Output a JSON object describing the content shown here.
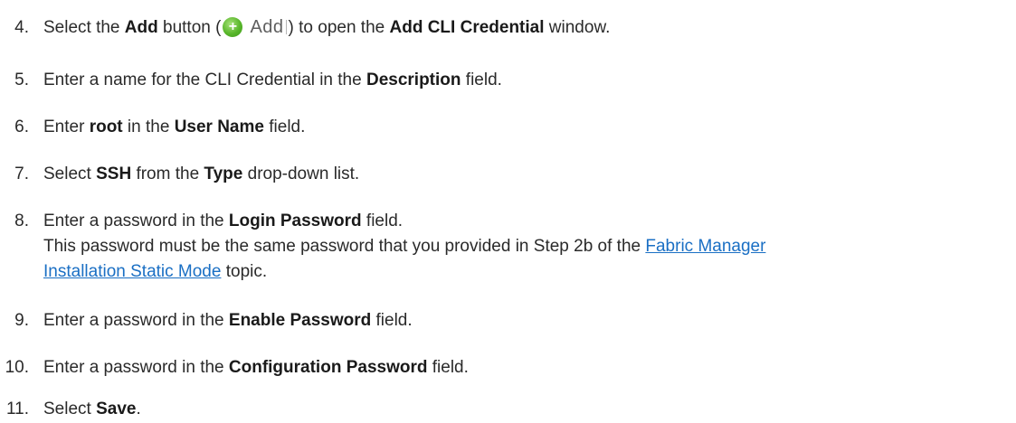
{
  "steps": [
    {
      "number": "4.",
      "parts": {
        "a": "Select the ",
        "b": "Add",
        "c": " button (",
        "icon_label": "Add",
        "d": ") to open the ",
        "e": "Add CLI Credential",
        "f": " window."
      }
    },
    {
      "number": "5.",
      "parts": {
        "a": "Enter a name for the CLI Credential in the ",
        "b": "Description",
        "c": " field."
      }
    },
    {
      "number": "6.",
      "parts": {
        "a": "Enter ",
        "b": "root",
        "c": " in the ",
        "d": "User Name",
        "e": " field."
      }
    },
    {
      "number": "7.",
      "parts": {
        "a": "Select ",
        "b": "SSH",
        "c": " from the ",
        "d": "Type",
        "e": " drop-down list."
      }
    },
    {
      "number": "8.",
      "parts": {
        "a": "Enter a password in the ",
        "b": "Login Password",
        "c": " field.",
        "note_a": "This password must be the same password that you provided in Step 2b of the ",
        "link_1": "Fabric Manager",
        "link_2": "Installation Static Mode",
        "note_b": " topic."
      }
    },
    {
      "number": "9.",
      "parts": {
        "a": "Enter a password in the ",
        "b": "Enable Password",
        "c": " field."
      }
    },
    {
      "number": "10.",
      "parts": {
        "a": "Enter a password in the ",
        "b": "Configuration Password",
        "c": " field."
      }
    },
    {
      "number": "11.",
      "parts": {
        "a": "Select ",
        "b": "Save",
        "c": "."
      }
    }
  ],
  "icons": {
    "add_button_icon": "plus-circle-icon",
    "accent_green": "#58b62a",
    "link_color": "#1a6fc4"
  }
}
